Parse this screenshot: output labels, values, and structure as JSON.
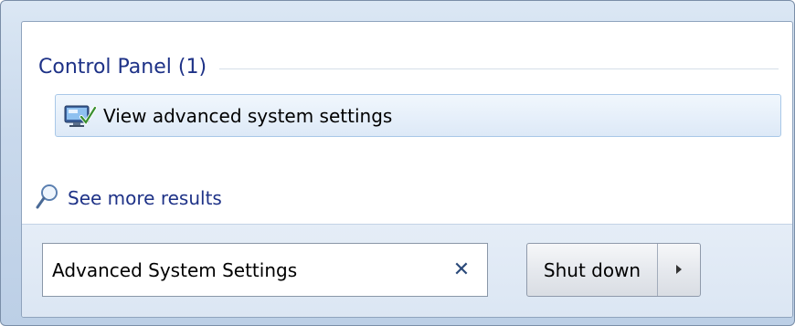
{
  "section": {
    "title": "Control Panel (1)"
  },
  "results": [
    {
      "label": "View advanced system settings",
      "icon": "system-settings-icon"
    }
  ],
  "see_more": {
    "label": "See more results",
    "icon": "search-magnifier-icon"
  },
  "search": {
    "value": "Advanced System Settings",
    "clear_symbol": "✕"
  },
  "power": {
    "shutdown_label": "Shut down",
    "arrow_icon": "triangle-right-icon"
  }
}
